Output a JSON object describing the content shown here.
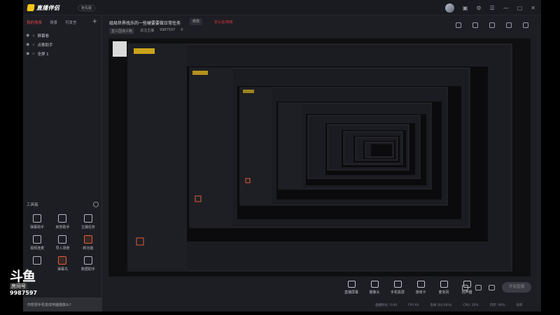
{
  "app": {
    "logo_text": "直播伴侣",
    "beta_label": "抢先版"
  },
  "left_panel": {
    "tabs": [
      "我的场景",
      "场景",
      "可发言"
    ],
    "add_label": "+",
    "scenes": [
      {
        "label": "屏幕卷"
      },
      {
        "label": "点歌助手"
      },
      {
        "label": "全屏 1"
      }
    ],
    "tools_title": "工具箱",
    "tools": [
      {
        "label": "弹幕助手",
        "highlight": false
      },
      {
        "label": "房管助手",
        "highlight": false
      },
      {
        "label": "主播任务",
        "highlight": false
      },
      {
        "label": "视频连麦",
        "highlight": false
      },
      {
        "label": "导入场景",
        "highlight": false
      },
      {
        "label": "新功能",
        "highlight": true
      },
      {
        "label": "",
        "highlight": false
      },
      {
        "label": "弹幕鸟",
        "highlight": true
      },
      {
        "label": "数据助手",
        "highlight": false
      }
    ]
  },
  "room": {
    "title": "组局世界找乐的一些硬要要做日常任务",
    "tag": "修改",
    "link": "去认证/高级",
    "category": "直三国演义略",
    "follow_label": "关注主播",
    "room_id": "9987597",
    "likes": "0"
  },
  "bottom_toolbar": {
    "tools": [
      "直播屏幕",
      "摄像头",
      "手机投屏",
      "游戏卡",
      "麦克风",
      "扬声器"
    ],
    "live_button": "开始直播",
    "status": [
      "直播时长: 0:00",
      "FPS 60",
      "丢帧 0(0.00%)",
      "CPU: 20%",
      "内存: 40%",
      "码率"
    ]
  },
  "overlay": {
    "brand": "斗鱼",
    "room_label": "房间号",
    "room_number": "9987597"
  },
  "popup": {
    "text": "你想把手机变成电脑摄像头?"
  }
}
